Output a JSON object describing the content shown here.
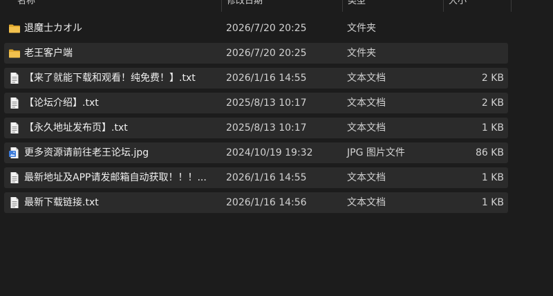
{
  "columns": {
    "name": "名称",
    "date": "修改日期",
    "type": "类型",
    "size": "大小"
  },
  "files": [
    {
      "icon": "folder-icon",
      "name": "退魔士カオル",
      "date": "2026/7/20 20:25",
      "type": "文件夹",
      "size": ""
    },
    {
      "icon": "folder-icon",
      "name": "老王客户端",
      "date": "2026/7/20 20:25",
      "type": "文件夹",
      "size": ""
    },
    {
      "icon": "text-file-icon",
      "name": "【来了就能下载和观看！纯免费！】.txt",
      "date": "2026/1/16 14:55",
      "type": "文本文档",
      "size": "2 KB"
    },
    {
      "icon": "text-file-icon",
      "name": "【论坛介绍】.txt",
      "date": "2025/8/13 10:17",
      "type": "文本文档",
      "size": "2 KB"
    },
    {
      "icon": "text-file-icon",
      "name": "【永久地址发布页】.txt",
      "date": "2025/8/13 10:17",
      "type": "文本文档",
      "size": "1 KB"
    },
    {
      "icon": "image-file-icon",
      "name": "更多资源请前往老王论坛.jpg",
      "date": "2024/10/19 19:32",
      "type": "JPG 图片文件",
      "size": "86 KB"
    },
    {
      "icon": "text-file-icon",
      "name": "最新地址及APP请发邮箱自动获取！！！...",
      "date": "2026/1/16 14:55",
      "type": "文本文档",
      "size": "1 KB"
    },
    {
      "icon": "text-file-icon",
      "name": "最新下载链接.txt",
      "date": "2026/1/16 14:56",
      "type": "文本文档",
      "size": "1 KB"
    }
  ],
  "colors": {
    "background": "#1c1c1c",
    "row_background": "#2b2b2b",
    "folder": "#f2c14e",
    "image_icon": "#3b7bd9"
  }
}
